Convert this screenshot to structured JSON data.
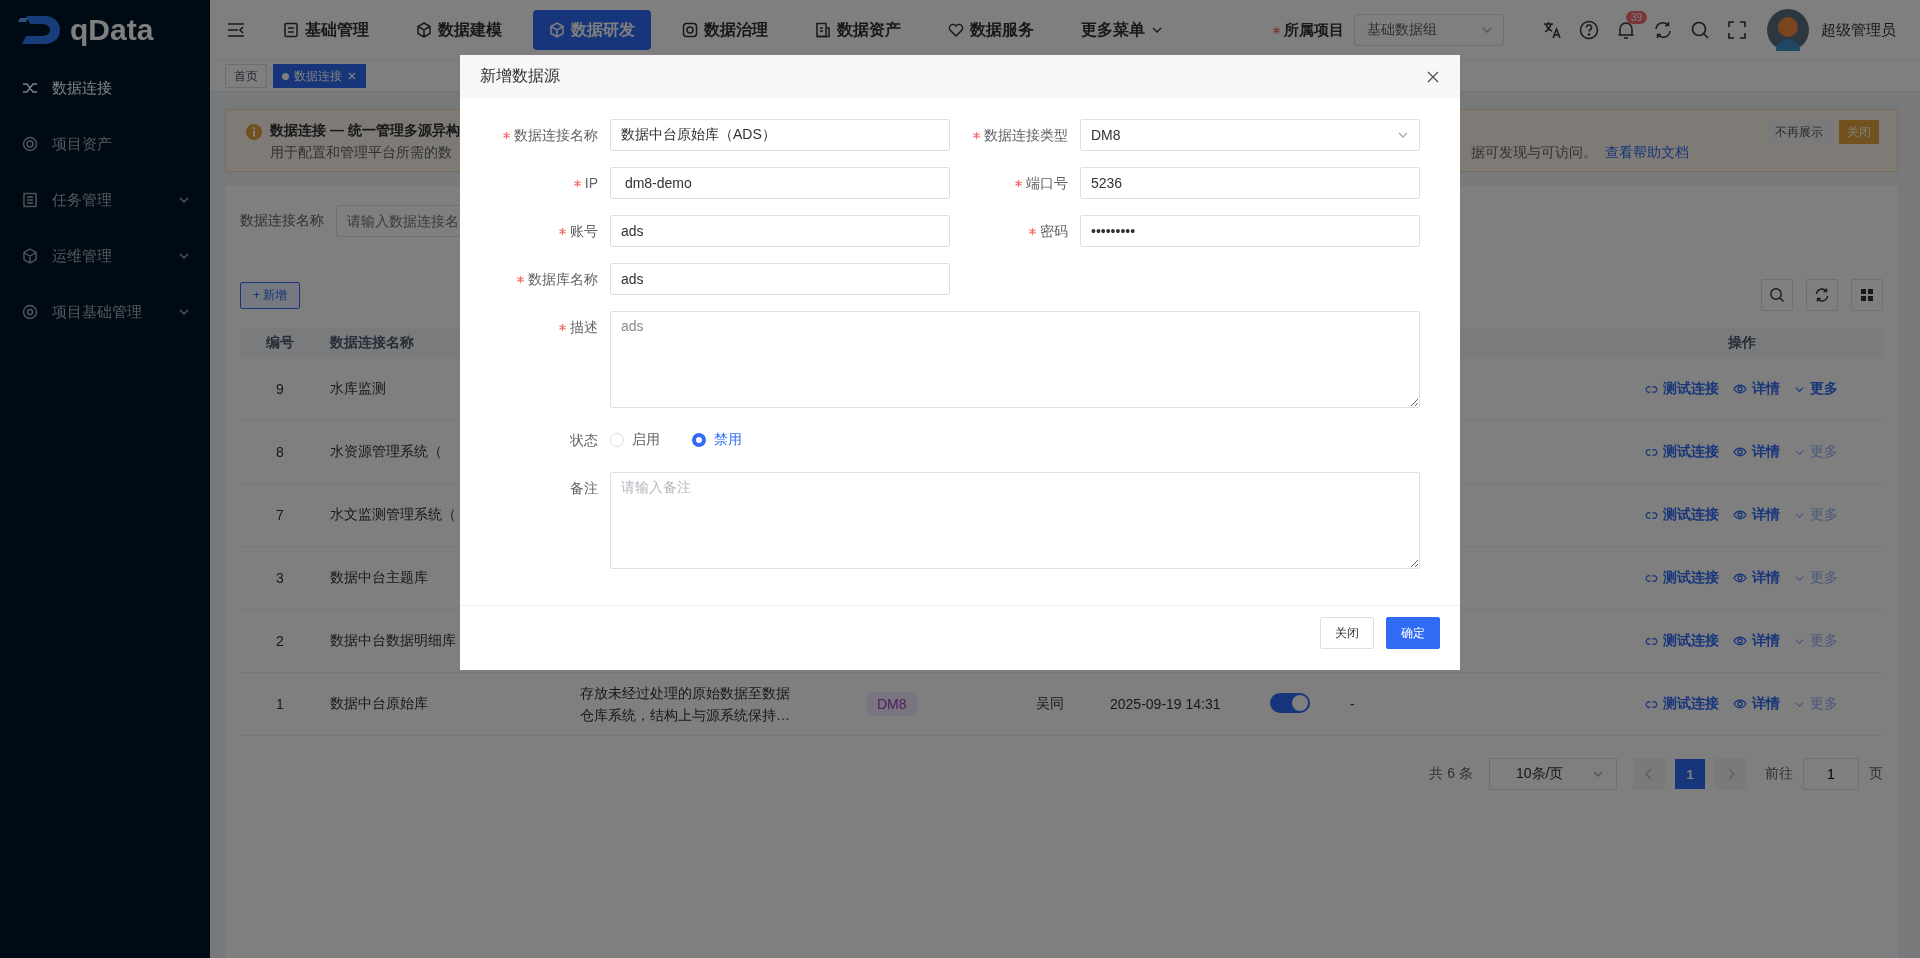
{
  "brand": {
    "name": "qData"
  },
  "sidebar": {
    "items": [
      {
        "label": "数据连接",
        "selected": true
      },
      {
        "label": "项目资产",
        "selected": false
      },
      {
        "label": "任务管理",
        "selected": false,
        "expanded": false
      },
      {
        "label": "运维管理",
        "selected": false,
        "expanded": false
      },
      {
        "label": "项目基础管理",
        "selected": false,
        "expanded": false
      }
    ]
  },
  "topbar": {
    "menus": [
      {
        "label": "基础管理",
        "selected": false
      },
      {
        "label": "数据建模",
        "selected": false
      },
      {
        "label": "数据研发",
        "selected": true
      },
      {
        "label": "数据治理",
        "selected": false
      },
      {
        "label": "数据资产",
        "selected": false
      },
      {
        "label": "数据服务",
        "selected": false
      },
      {
        "label": "更多菜单",
        "selected": false,
        "kind": "dropdown"
      }
    ],
    "project": {
      "label": "所属项目",
      "required": true,
      "value": "基础数据组"
    },
    "notification_count": "39",
    "user": "超级管理员"
  },
  "tabs": [
    {
      "label": "首页",
      "selected": false
    },
    {
      "label": "数据连接",
      "selected": true,
      "closable": true
    }
  ],
  "notice": {
    "title": "数据连接 — 统一管理多源异构",
    "text_start": "用于配置和管理平台所需的数",
    "text_end": "据可发现与可访问。",
    "link": "查看帮助文档",
    "buttons": [
      "不再展示",
      "关闭"
    ]
  },
  "search": {
    "label": "数据连接名称",
    "placeholder": "请输入数据连接名"
  },
  "toolbar": {
    "add": "+ 新增"
  },
  "table": {
    "columns": [
      "编号",
      "数据连接名称",
      "操作"
    ],
    "rows": [
      {
        "id": "9",
        "name": "水库监测",
        "test": "测试连接",
        "detail": "详情",
        "more": "更多",
        "more_disabled": false
      },
      {
        "id": "8",
        "name": "水资源管理系统（",
        "test": "测试连接",
        "detail": "详情",
        "more": "更多",
        "more_disabled": true
      },
      {
        "id": "7",
        "name": "水文监测管理系统（",
        "test": "测试连接",
        "detail": "详情",
        "more": "更多",
        "more_disabled": true
      },
      {
        "id": "3",
        "name": "数据中台主题库",
        "test": "测试连接",
        "detail": "详情",
        "more": "更多",
        "more_disabled": true
      },
      {
        "id": "2",
        "name": "数据中台数据明细库",
        "test": "测试连接",
        "detail": "详情",
        "more": "更多",
        "more_disabled": true
      },
      {
        "id": "1",
        "name": "数据中台原始库",
        "description": "存放未经过处理的原始数据至数据仓库系统，结构上与源系统保持…",
        "type": "DM8",
        "creator": "吴同",
        "created": "2025-09-19 14:31",
        "enabled": true,
        "remark": "-",
        "test": "测试连接",
        "detail": "详情",
        "more": "更多",
        "more_disabled": true
      }
    ]
  },
  "pagination": {
    "total": "共 6 条",
    "page_size": "10条/页",
    "pages": [
      {
        "label": "1",
        "selected": true
      }
    ],
    "goto_label": "前往",
    "goto_value": "1",
    "page_suffix": "页"
  },
  "dialog": {
    "title": "新增数据源",
    "fields": [
      {
        "label": "数据连接名称",
        "required": true,
        "kind": "text",
        "value": "数据中台原始库（ADS）"
      },
      {
        "label": "数据连接类型",
        "required": true,
        "kind": "select",
        "value": "DM8"
      },
      {
        "label": "IP",
        "required": true,
        "kind": "text",
        "value": " dm8-demo"
      },
      {
        "label": "端口号",
        "required": true,
        "kind": "text",
        "value": "5236"
      },
      {
        "label": "账号",
        "required": true,
        "kind": "text",
        "value": "ads"
      },
      {
        "label": "密码",
        "required": true,
        "kind": "text",
        "value": "•••••••••"
      },
      {
        "label": "数据库名称",
        "required": true,
        "kind": "text",
        "value": "ads"
      },
      {
        "label": "描述",
        "required": true,
        "kind": "textarea",
        "value": "ads"
      },
      {
        "label": "状态",
        "required": false,
        "kind": "radio",
        "options": [
          {
            "label": "启用",
            "selected": false
          },
          {
            "label": "禁用",
            "selected": true
          }
        ]
      },
      {
        "label": "备注",
        "required": false,
        "kind": "textarea",
        "placeholder": "请输入备注"
      }
    ],
    "buttons": [
      {
        "label": "关闭",
        "kind": "default"
      },
      {
        "label": "确定",
        "kind": "primary"
      }
    ]
  }
}
